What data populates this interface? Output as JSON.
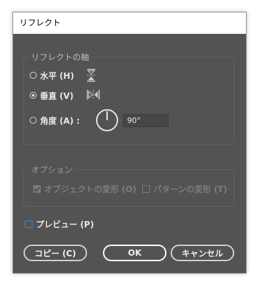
{
  "window": {
    "title": "リフレクト"
  },
  "axis_group": {
    "legend": "リフレクトの軸",
    "horizontal_label": "水平 (H)",
    "vertical_label": "垂直 (V)",
    "angle_label": "角度 (A) :",
    "angle_value": "90°",
    "selected": "vertical"
  },
  "options_group": {
    "legend": "オプション",
    "objects_label": "オブジェクトの変形 (O)",
    "objects_checked": true,
    "patterns_label": "パターンの変形 (T)",
    "patterns_checked": false
  },
  "preview": {
    "label": "プレビュー (P)",
    "checked": false
  },
  "buttons": {
    "copy": "コピー (C)",
    "ok": "OK",
    "cancel": "キャンセル"
  },
  "colors": {
    "dialog_bg": "#535353",
    "checkbox_accent": "#2d8ceb"
  }
}
